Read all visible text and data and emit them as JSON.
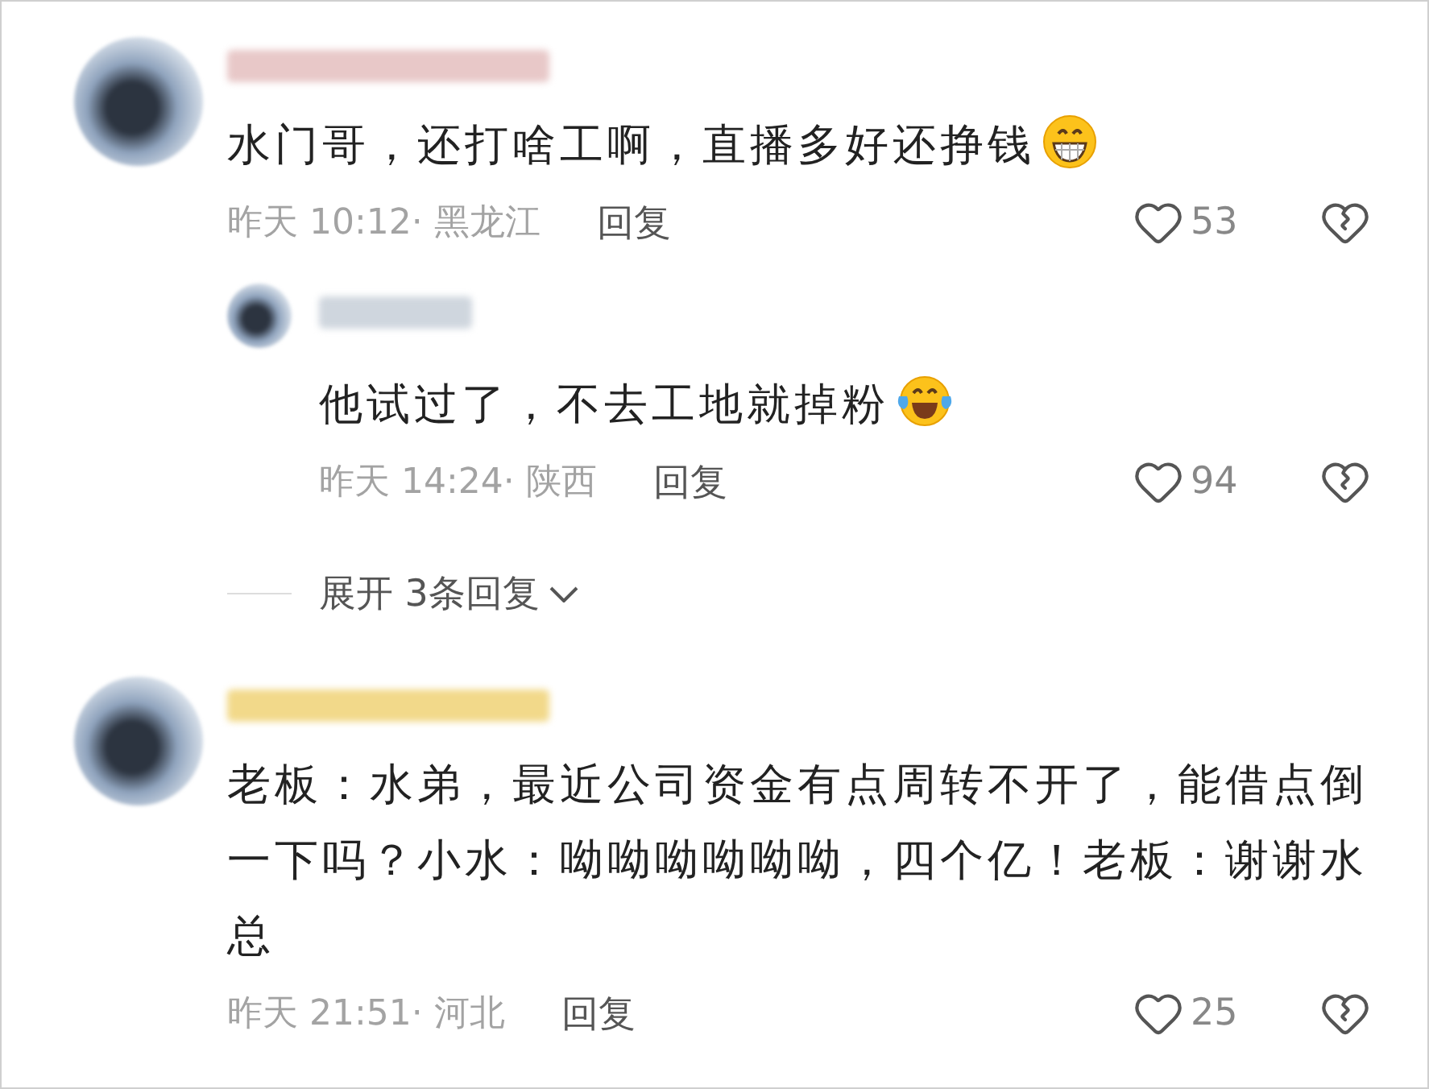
{
  "comments": [
    {
      "text": "水门哥，还打啥工啊，直播多好还挣钱",
      "emoji": {
        "kind": "grin"
      },
      "meta": "昨天 10:12· 黑龙江",
      "reply_label": "回复",
      "likes": "53",
      "replies": [
        {
          "text": "他试过了，不去工地就掉粉",
          "emoji": {
            "kind": "tears"
          },
          "meta": "昨天 14:24· 陕西",
          "reply_label": "回复",
          "likes": "94"
        }
      ],
      "expand_label": "展开 3条回复"
    },
    {
      "text": "老板：水弟，最近公司资金有点周转不开了，能借点倒一下吗？小水：呦呦呦呦呦呦，四个亿！老板：谢谢水总",
      "meta": "昨天 21:51· 河北",
      "reply_label": "回复",
      "likes": "25"
    }
  ]
}
